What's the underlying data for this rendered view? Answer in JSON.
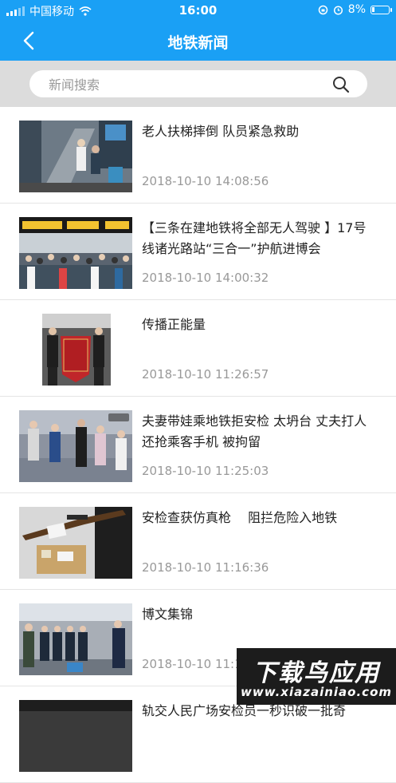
{
  "status_bar": {
    "carrier": "中国移动",
    "time": "16:00",
    "battery": "8%",
    "icons": [
      "signal-icon",
      "wifi-icon",
      "rotation-lock-icon",
      "alarm-icon",
      "battery-icon"
    ]
  },
  "nav": {
    "title": "地铁新闻",
    "back_icon": "chevron-left-icon"
  },
  "search": {
    "placeholder": "新闻搜索",
    "icon": "search-icon"
  },
  "news": [
    {
      "title": "老人扶梯摔倒 队员紧急救助",
      "date": "2018-10-10 14:08:56"
    },
    {
      "title": "【三条在建地铁将全部无人驾驶 】17号线诸光路站“三合一”护航进博会",
      "date": "2018-10-10 14:00:32"
    },
    {
      "title": "传播正能量",
      "date": "2018-10-10 11:26:57"
    },
    {
      "title": "夫妻带娃乘地铁拒安检 太坍台 丈夫打人还抢乘客手机 被拘留",
      "date": "2018-10-10 11:25:03"
    },
    {
      "title": "安检查获仿真枪　 阻拦危险入地铁",
      "date": "2018-10-10 11:16:36"
    },
    {
      "title": "博文集锦",
      "date": "2018-10-10 11:1"
    },
    {
      "title": "轨交人民广场安检员一秒识破一批奇",
      "date": ""
    }
  ],
  "watermark": {
    "text": "下载鸟应用",
    "url": "www.xiazainiao.com"
  },
  "colors": {
    "accent": "#1aa0f5",
    "search_bg": "#dcdcdc",
    "date_text": "#999999"
  }
}
